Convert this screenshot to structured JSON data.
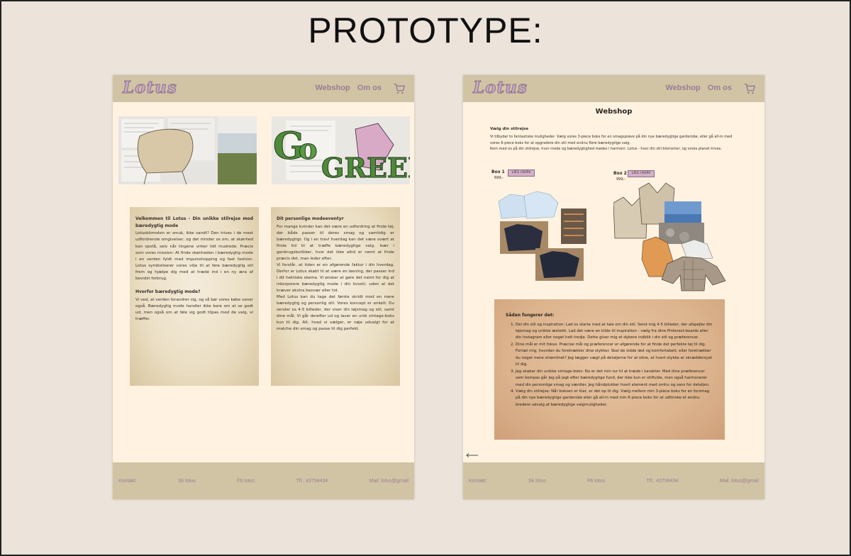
{
  "frame": {
    "title": "PROTOTYPE:"
  },
  "header": {
    "logo": "Lotus",
    "nav": [
      {
        "label": "Webshop"
      },
      {
        "label": "Om os"
      }
    ]
  },
  "footer": {
    "items": [
      {
        "label": "Kontakt:"
      },
      {
        "label": "Sk lotus"
      },
      {
        "label": "Fb lotus"
      },
      {
        "label": "Tlf.: 43798434"
      },
      {
        "label": "Mail: lotus@gmail"
      }
    ]
  },
  "left_page": {
    "card1": {
      "heading": "Velkommen til Lotus - Din unikke stilrejse mod bæredygtig mode",
      "p1": "Lotusblomsten er smuk, ikke sandt? Den trives i de mest udfordrende omgivelser, og det minder os om, at skønhed kan opstå, selv når tingene virker lidt mudrede. Præcis som vores mission: At finde skønheden i bæredygtig mode i en verden fyldt med impulsshopping og fast fashion. Lotus symboliserer vores vilje til at føre bæredygtig stil frem og hjælpe dig med at træde ind i en ny æra af bevidst forbrug.",
      "subheading": "Hvorfor bæredygtig mode?",
      "p2": "Vi ved, at verden forandrer sig, og så bør vores købe vaner også. Bæredygtig mode handler ikke bare om at se godt ud, men også om at føle sig godt tilpas med de valg, vi træffer."
    },
    "card2": {
      "heading": "Dit personlige modeeventyr",
      "p1": "For mange kvinder kan det være en udfordring at finde tøj, der både passer til deres smag og samtidig er bæredygtigt. Og i en travl hverdag kan det være svært at finde tid til at træffe bæredygtige valg. Især i genbrugsbutikker, hvor det ikke altid er nemt at finde præcis det, man leder efter.",
      "p2": "Vi forstår, at tiden er en afgørende faktor i din hverdag. Derfor er Lotus skabt til at være en løsning, der passer ind i dit hektiske skema. Vi ønsker at gøre det nemt for dig at inkorporere bæredygtig mode i din livsstil, uden at det kræver ekstra besvær eller tid.",
      "p3": "Med Lotus kan du tage det første skridt mod en mere bæredygtig og personlig stil. Vores koncept er enkelt: Du sender os 4-5 billeder, der viser din tøjsmag og stil, samt dine mål. Vi går derefter ud og laver en unik vintage-boks kun til dig. Alt, hvad vi vælger, er nøje udvalgt for at matche din smag og passe til dig perfekt."
    }
  },
  "right_page": {
    "title": "Webshop",
    "intro_heading": "Vælg din stilrejse",
    "intro_p1": "Vi tilbyder to fantastiske muligheder. Vælg vores 3-piece boks for en smagsprøve på din nye bæredygtige garderobe, eller gå all-in med vores 6-piece boks for at opgradere din stil med endnu flere bæredygtige valg.",
    "intro_p2": "Kom med os på din stilrejse, hvor mode og bæredygtighed mødes i harmoni. Lotus - hvor din stil blomstrer, og vores planet trives.",
    "box1": {
      "label": "Box 1",
      "price": "699,-",
      "button": "LÆG I KURV"
    },
    "box2": {
      "label": "Box 2",
      "price": "999,-",
      "button": "LÆG I KURV"
    },
    "how_heading": "Sådan fungerer det:",
    "steps": [
      "Del din stil og inspiration: Lad os starte med at tale om din stil. Send mig 4-5 billeder, der afspejler din tøjsmag og unikke æstetik. Lad det være en kilde til inspiration - vælg fra dine Pinterest-boards eller din Instagram eller noget helt tredje. Dette giver mig et dybere indblik i din stil og præferencer.",
      "Dine mål er mit fokus: Præcise mål og præferencer er afgørende for at finde det perfekte tøj til dig. Fortæl mig, hvordan du foretrækker dine stykker. Skal de sidde løst og komfortabelt, eller foretrækker du noget mere strømlinet? Jeg lægger vægt på detaljerne for at sikre, at hvert stykke er skræddersyet til dig.",
      "Jeg skaber din unikke vintage-boks: Nu er det min tur til at træde i karakter. Med dine præferencer som kompas går jeg på jagt efter bæredygtige fund, der ikke kun er stilfulde, men også harmonerer med din personlige smag og værdier. Jeg håndplukker hvert element med omhu og sans for detaljen.",
      "Vælg din stilrejse: Når boksen er klar, er det op til dig. Vælg mellem min 3-piece boks for en forsmag på din nye bæredygtige garderobe eller gå all-in med min 6-piece boks for at udforske et endnu bredere udvalg af bæredygtige valgmuligheder."
    ]
  }
}
